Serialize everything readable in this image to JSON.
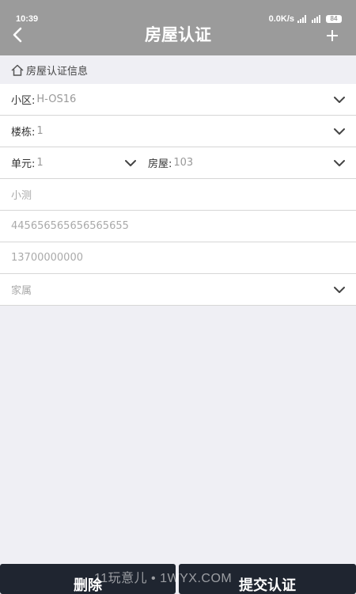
{
  "status_bar": {
    "time": "10:39",
    "network_speed": "0.0K/s",
    "battery": "84"
  },
  "header": {
    "back_icon": "chevron-left-icon",
    "title": "房屋认证",
    "add_icon": "plus-icon"
  },
  "section": {
    "icon": "home-icon",
    "title": "房屋认证信息"
  },
  "form": {
    "community": {
      "label": "小区:",
      "value": "H-OS16"
    },
    "building": {
      "label": "楼栋:",
      "value": "1"
    },
    "unit": {
      "label": "单元:",
      "value": "1"
    },
    "room": {
      "label": "房屋:",
      "value": "103"
    },
    "name": {
      "value": "小测"
    },
    "id_number": {
      "value": "445656565656565655"
    },
    "phone": {
      "value": "13700000000"
    },
    "relation": {
      "value": "家属"
    }
  },
  "actions": {
    "delete_label": "删除",
    "submit_label": "提交认证"
  },
  "watermark": "11玩意儿 • 1WYX.COM",
  "colors": {
    "header_bg": "#9b9b9b",
    "page_bg": "#efeff4",
    "button_bg": "#1f2530"
  }
}
